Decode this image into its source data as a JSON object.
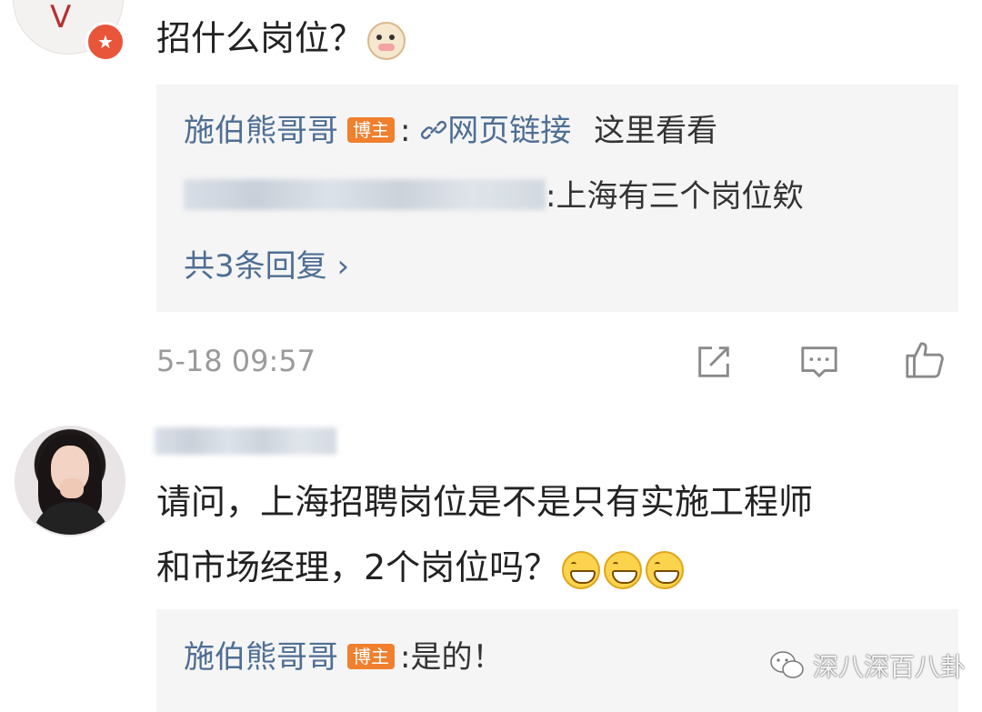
{
  "comment1": {
    "text": "招什么岗位？",
    "emoji": "cow-face-emoji",
    "replies": [
      {
        "user": "施伯熊哥哥",
        "badge": "博主",
        "sep": ":",
        "link_label": "网页链接",
        "text": "这里看看"
      },
      {
        "user_blurred": true,
        "sep": ":",
        "text": "上海有三个岗位欸"
      }
    ],
    "more_replies": "共3条回复 ›",
    "timestamp": "5-18 09:57"
  },
  "comment2": {
    "text_line1": "请问，上海招聘岗位是不是只有实施工程师",
    "text_line2": "和市场经理，2个岗位吗？",
    "emojis": [
      "grin-emoji",
      "grin-emoji",
      "grin-emoji"
    ],
    "reply": {
      "user": "施伯熊哥哥",
      "badge": "博主",
      "sep": ":",
      "text": "是的！"
    }
  },
  "watermark": "深八深百八卦",
  "colors": {
    "link": "#4e6e94",
    "badge": "#f07f2e",
    "reply_bg": "#f5f5f5",
    "timestamp": "#9a9a9a"
  }
}
